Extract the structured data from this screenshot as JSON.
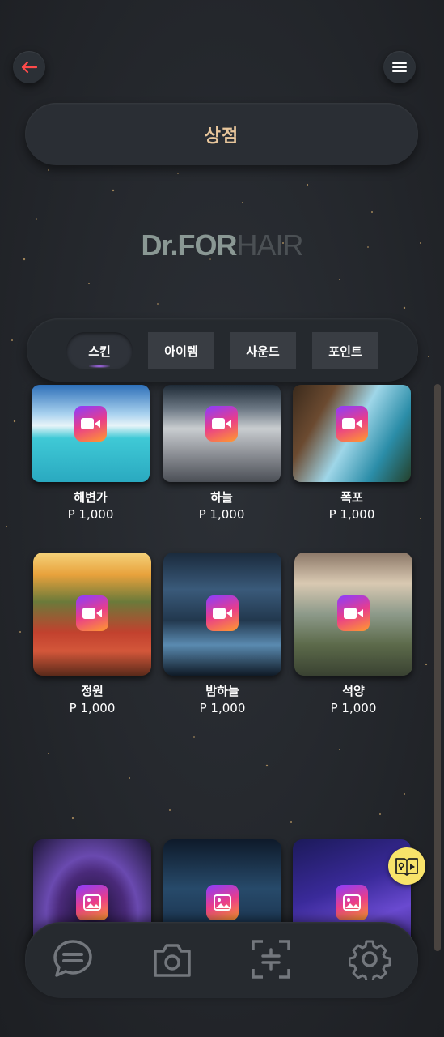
{
  "header": {
    "title": "상점",
    "back_icon": "arrow-left-icon",
    "menu_icon": "hamburger-menu-icon"
  },
  "brand": {
    "part1": "Dr.FOR",
    "part2": "HAIR"
  },
  "tabs": [
    {
      "label": "스킨",
      "active": true
    },
    {
      "label": "아이템",
      "active": false
    },
    {
      "label": "사운드",
      "active": false
    },
    {
      "label": "포인트",
      "active": false
    }
  ],
  "items": [
    {
      "name": "해변가",
      "price": "P 1,000",
      "type": "video"
    },
    {
      "name": "하늘",
      "price": "P 1,000",
      "type": "video"
    },
    {
      "name": "폭포",
      "price": "P 1,000",
      "type": "video"
    },
    {
      "name": "정원",
      "price": "P 1,000",
      "type": "video"
    },
    {
      "name": "밤하늘",
      "price": "P 1,000",
      "type": "video"
    },
    {
      "name": "석양",
      "price": "P 1,000",
      "type": "video"
    },
    {
      "name": "",
      "price": "",
      "type": "image"
    },
    {
      "name": "",
      "price": "",
      "type": "image"
    },
    {
      "name": "",
      "price": "",
      "type": "image"
    }
  ],
  "bottom_nav": [
    {
      "icon": "chat-bubble-icon"
    },
    {
      "icon": "camera-icon"
    },
    {
      "icon": "scan-icon"
    },
    {
      "icon": "gear-icon"
    }
  ],
  "colors": {
    "title": "#e9c79c",
    "accent": "#b16cff",
    "guide": "#f8e36a"
  }
}
